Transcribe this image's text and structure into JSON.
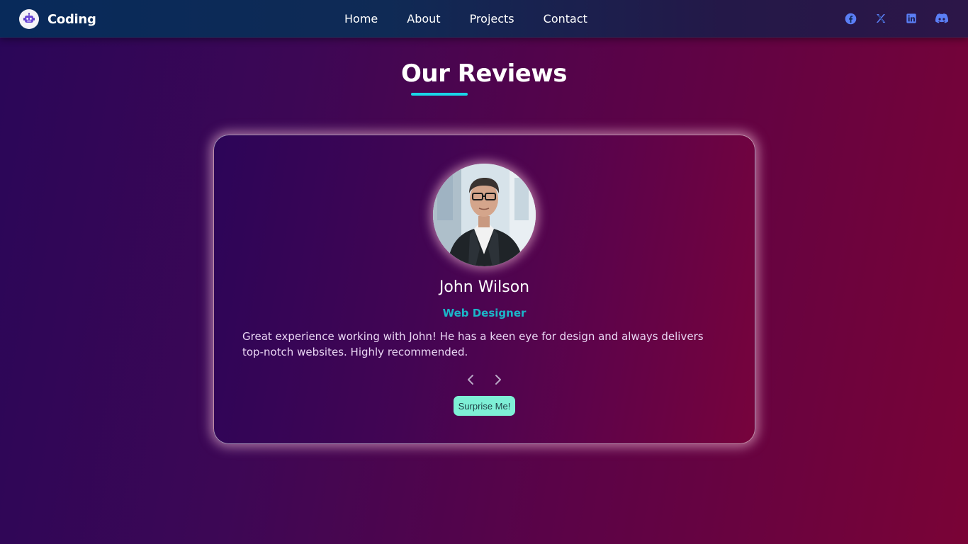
{
  "nav": {
    "brand": "Coding",
    "links": [
      {
        "label": "Home"
      },
      {
        "label": "About"
      },
      {
        "label": "Projects"
      },
      {
        "label": "Contact"
      }
    ],
    "socials": [
      "facebook-icon",
      "x-icon",
      "linkedin-icon",
      "discord-icon"
    ]
  },
  "section": {
    "title": "Our Reviews"
  },
  "review": {
    "name": "John Wilson",
    "role": "Web Designer",
    "text": "Great experience working with John! He has a keen eye for design and always delivers top-notch websites. Highly recommended.",
    "surprise_label": "Surprise Me!"
  },
  "colors": {
    "accent_cyan": "#19d6e8",
    "role_color": "#1bb6c9",
    "button_bg": "#7ef0d6",
    "social_icon": "#5b7ef5"
  }
}
